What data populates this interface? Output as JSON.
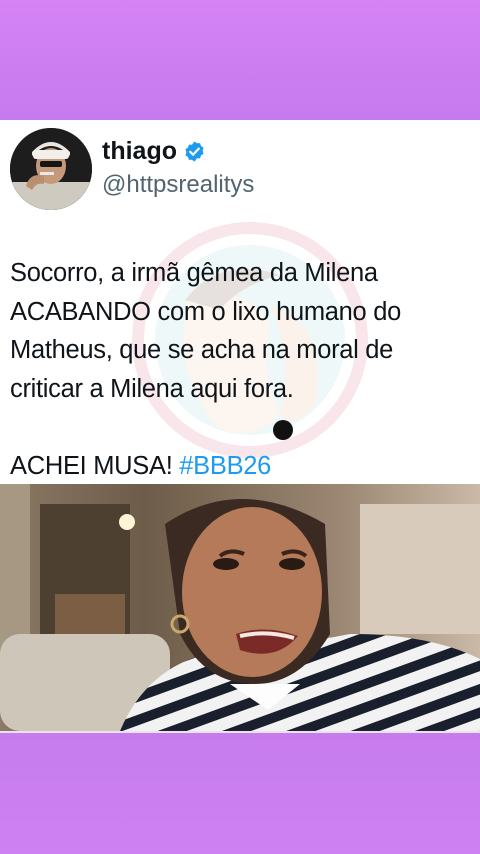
{
  "tweet": {
    "name": "thiago",
    "handle": "@httpsrealitys",
    "lines": [
      "Socorro, a irmã gêmea da Milena",
      "ACABANDO com o lixo humano do",
      "Matheus, que se acha na moral de",
      "criticar a Milena aqui fora."
    ],
    "closing_text": "ACHEI MUSA! ",
    "hashtag": "#BBB26"
  },
  "icons": {
    "verified": "verified-badge-icon",
    "watermark": "watermark-logo"
  },
  "colors": {
    "background": "#c97df0",
    "card": "#ffffff",
    "text": "#0f1419",
    "handle": "#536471",
    "hashtag": "#1d9bf0",
    "verified": "#1d9bf0"
  }
}
